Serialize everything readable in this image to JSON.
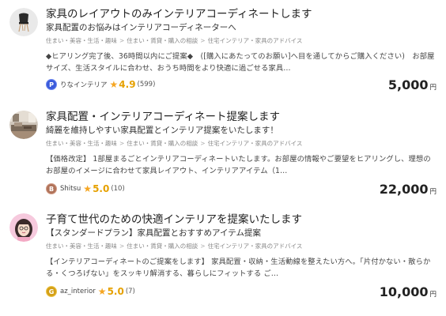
{
  "listings": [
    {
      "title": "家具のレイアウトのみインテリアコーディネートします",
      "subtitle": "家具配置のお悩みはインテリアコーディネーターへ",
      "breadcrumbs": [
        "住まい・美容・生活・趣味",
        "住まい・賃貸・購入の相談",
        "住宅インテリア・家具のアドバイス"
      ],
      "description": "◆ヒアリング完了後、36時間以内にご提案◆　([購入にあたってのお願い]へ目を通してからご購入ください)　お部屋サイズ、生活スタイルに合わせ、おうち時間をより快適に過ごせる家具…",
      "seller": "りなインテリア",
      "badge": "P",
      "rating": "4.9",
      "reviews": "(599)",
      "price": "5,000",
      "currency": "円"
    },
    {
      "title": "家具配置・インテリアコーディネート提案します",
      "subtitle": "綺麗を維持しやすい家具配置とインテリア提案をいたします！",
      "breadcrumbs": [
        "住まい・美容・生活・趣味",
        "住まい・賃貸・購入の相談",
        "住宅インテリア・家具のアドバイス"
      ],
      "description": "【価格改定】 1部屋まるごとインテリアコーディネートいたします。お部屋の情報やご要望をヒアリングし、理想のお部屋のイメージに合わせて家具レイアウト、インテリアアイテム（1…",
      "seller": "Shitsu",
      "badge": "B",
      "rating": "5.0",
      "reviews": "(10)",
      "price": "22,000",
      "currency": "円"
    },
    {
      "title": "子育て世代のための快適インテリアを提案いたします",
      "subtitle": "【スタンダードプラン】家具配置とおすすめアイテム提案",
      "breadcrumbs": [
        "住まい・美容・生活・趣味",
        "住まい・賃貸・購入の相談",
        "住宅インテリア・家具のアドバイス"
      ],
      "description": "【インテリアコーディネートのご提案をします】 家具配置・収納・生活動線を整えたい方へ。「片付かない・散らかる・くつろげない」をスッキリ解消する、暮らしにフィットする ご…",
      "seller": "az_interior",
      "badge": "G",
      "rating": "5.0",
      "reviews": "(7)",
      "price": "10,000",
      "currency": "円"
    }
  ],
  "colors": {
    "badge_p": "#3b5bdb",
    "badge_b": "#b0735a",
    "badge_g": "#d4a017",
    "star": "#f5a623",
    "rating": "#e6a100"
  },
  "icons": {
    "avatar_1": "chair-icon",
    "avatar_2": "room-photo",
    "avatar_3": "woman-illustration"
  }
}
